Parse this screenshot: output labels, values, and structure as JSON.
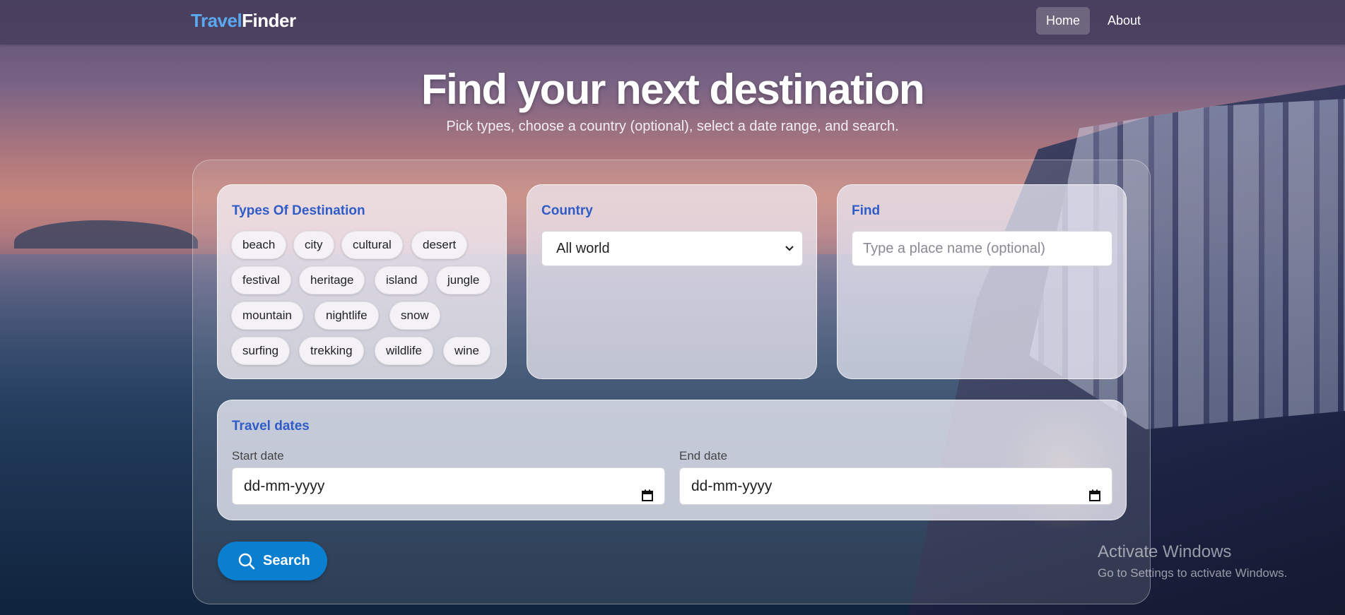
{
  "nav": {
    "logo_part1": "Travel",
    "logo_part2": "Finder",
    "links": [
      "Home",
      "About"
    ]
  },
  "hero": {
    "title": "Find your next destination",
    "subtitle": "Pick types, choose a country (optional), select a date range, and search."
  },
  "types": {
    "title": "Types Of Destination",
    "chips": [
      "beach",
      "city",
      "cultural",
      "desert",
      "festival",
      "heritage",
      "island",
      "jungle",
      "mountain",
      "nightlife",
      "snow",
      "surfing",
      "trekking",
      "wildlife",
      "wine"
    ]
  },
  "country": {
    "title": "Country",
    "selected": "All world"
  },
  "find": {
    "title": "Find",
    "placeholder": "Type a place name (optional)"
  },
  "dates": {
    "title": "Travel dates",
    "start_label": "Start date",
    "start_value": "dd-mm-yyyy",
    "end_label": "End date",
    "end_value": "dd-mm-yyyy"
  },
  "search": {
    "label": "Search"
  },
  "os_watermark": {
    "line1": "Activate Windows",
    "line2": "Go to Settings to activate Windows."
  },
  "colors": {
    "accent": "#2f5cc7",
    "button": "#0b7fcf",
    "logo_blue": "#5aa8f2"
  },
  "icons": [
    "chevron-down-icon",
    "calendar-icon",
    "search-icon"
  ]
}
